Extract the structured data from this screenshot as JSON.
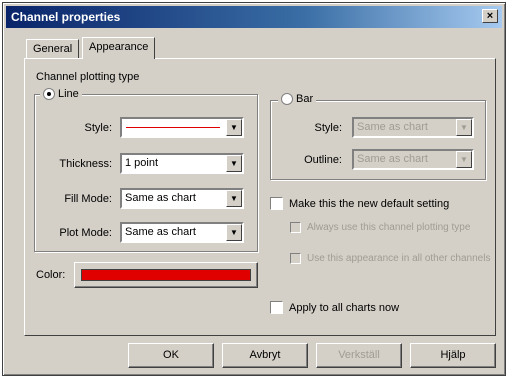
{
  "window": {
    "title": "Channel properties",
    "close_glyph": "×"
  },
  "tabs": [
    {
      "label": "General"
    },
    {
      "label": "Appearance"
    }
  ],
  "section_label": "Channel plotting type",
  "line_group": {
    "label": "Line",
    "style_label": "Style:",
    "thickness_label": "Thickness:",
    "thickness_value": "1 point",
    "fill_mode_label": "Fill Mode:",
    "fill_mode_value": "Same as chart",
    "plot_mode_label": "Plot Mode:",
    "plot_mode_value": "Same as chart"
  },
  "bar_group": {
    "label": "Bar",
    "style_label": "Style:",
    "style_value": "Same as chart",
    "outline_label": "Outline:",
    "outline_value": "Same as chart"
  },
  "color_label": "Color:",
  "colors": {
    "line_color": "#e00000",
    "window_bg": "#d4d0c8"
  },
  "default_setting": {
    "label": "Make this the new default setting",
    "sub1": "Always use this channel plotting type",
    "sub2": "Use this appearance in all other channels"
  },
  "apply_all_label": "Apply to all charts now",
  "buttons": {
    "ok": "OK",
    "cancel": "Avbryt",
    "apply": "Verkställ",
    "help": "Hjälp"
  }
}
